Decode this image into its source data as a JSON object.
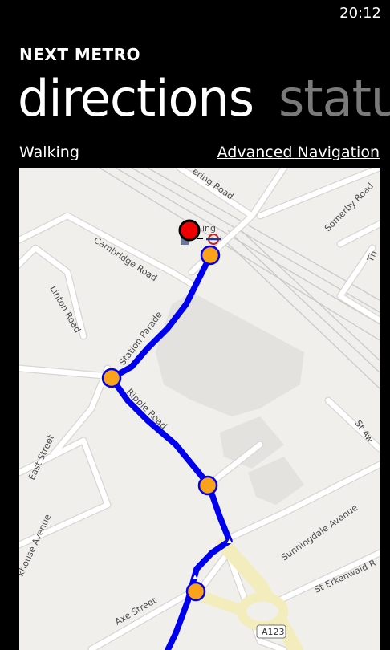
{
  "status_bar": {
    "time": "20:12"
  },
  "app": {
    "title": "NEXT METRO"
  },
  "pivot": {
    "tabs": [
      {
        "label": "directions"
      },
      {
        "label": "statu"
      }
    ]
  },
  "route": {
    "mode": "Walking",
    "advanced_link": "Advanced Navigation"
  },
  "map": {
    "street_labels": {
      "ring_road": "ering Road",
      "cambridge_road": "Cambridge Road",
      "linton_road": "Linton Road",
      "station_parade": "Station Parade",
      "ripple_road": "Ripple Road",
      "east_street": "East Street",
      "axe_street": "Axe Street",
      "sunningdale_avenue": "Sunningdale Avenue",
      "st_erkenwald": "St Erkenwald R",
      "somerby_road": "Somerby Road",
      "st_aw": "St Aw",
      "house_avenue": "khouse Avenue",
      "station_text": "ing",
      "road_t": "Th"
    },
    "road_shield": "A123",
    "colors": {
      "route": "#0000ee",
      "waypoint": "#f9a21a",
      "destination": "#ee0000"
    }
  }
}
